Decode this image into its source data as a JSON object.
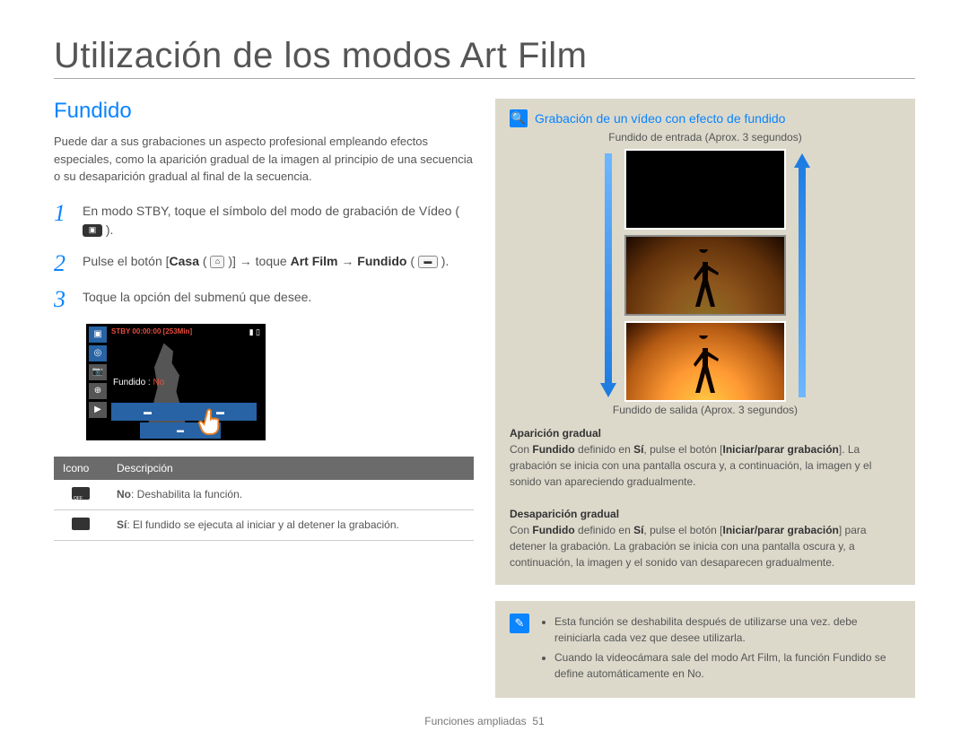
{
  "page": {
    "title": "Utilización de los modos Art Film",
    "footer_label": "Funciones ampliadas",
    "footer_number": "51"
  },
  "left": {
    "heading": "Fundido",
    "intro": "Puede dar a sus grabaciones un aspecto profesional empleando efectos especiales, como la aparición gradual de la imagen al principio de una secuencia o su desaparición gradual al final de la secuencia.",
    "steps": [
      {
        "num": "1",
        "text_pre": "En modo STBY, toque el símbolo del modo de grabación de Vídeo ( ",
        "text_post": " )."
      },
      {
        "num": "2",
        "text_pre": "Pulse el botón [",
        "casa": "Casa",
        "text_mid1": " ( ",
        "text_mid2": " )] → toque ",
        "artfilm": "Art Film",
        "arrow": " → ",
        "fundido": "Fundido",
        "text_mid3": " ( ",
        "text_post": " )."
      },
      {
        "num": "3",
        "text": "Toque la opción del submenú que desee."
      }
    ],
    "screen": {
      "status": "STBY 00:00:00 [253Min]",
      "label_prefix": "Fundido : ",
      "label_value": "No"
    },
    "table": {
      "headers": [
        "Icono",
        "Descripción"
      ],
      "rows": [
        {
          "label": "No",
          "desc": ": Deshabilita la función."
        },
        {
          "label": "Sí",
          "desc": ": El fundido se ejecuta al iniciar y al detener la grabación."
        }
      ]
    }
  },
  "right": {
    "box_title": "Grabación de un vídeo con efecto de fundido",
    "caption_in": "Fundido de entrada (Aprox. 3 segundos)",
    "caption_out": "Fundido de salida (Aprox. 3 segundos)",
    "fade_in": {
      "heading": "Aparición gradual",
      "p1a": "Con ",
      "p1b": "Fundido",
      "p1c": " definido en ",
      "p1d": "Sí",
      "p1e": ", pulse el botón [",
      "p1f": "Iniciar/parar grabación",
      "p1g": "]. La grabación se inicia con una pantalla oscura y, a continuación, la imagen y el sonido van apareciendo gradualmente."
    },
    "fade_out": {
      "heading": "Desaparición gradual",
      "p1a": "Con ",
      "p1b": "Fundido",
      "p1c": " definido en ",
      "p1d": "Sí",
      "p1e": ", pulse el botón [",
      "p1f": "Iniciar/parar grabación",
      "p1g": "] para detener la grabación. La grabación se inicia con una pantalla oscura y, a continuación, la imagen y el sonido van desaparecen gradualmente."
    },
    "notes": [
      "Esta función se deshabilita después de utilizarse una vez. debe reiniciarla cada vez que desee utilizarla.",
      "Cuando la videocámara sale del modo Art Film, la función Fundido se define automáticamente en No."
    ]
  }
}
